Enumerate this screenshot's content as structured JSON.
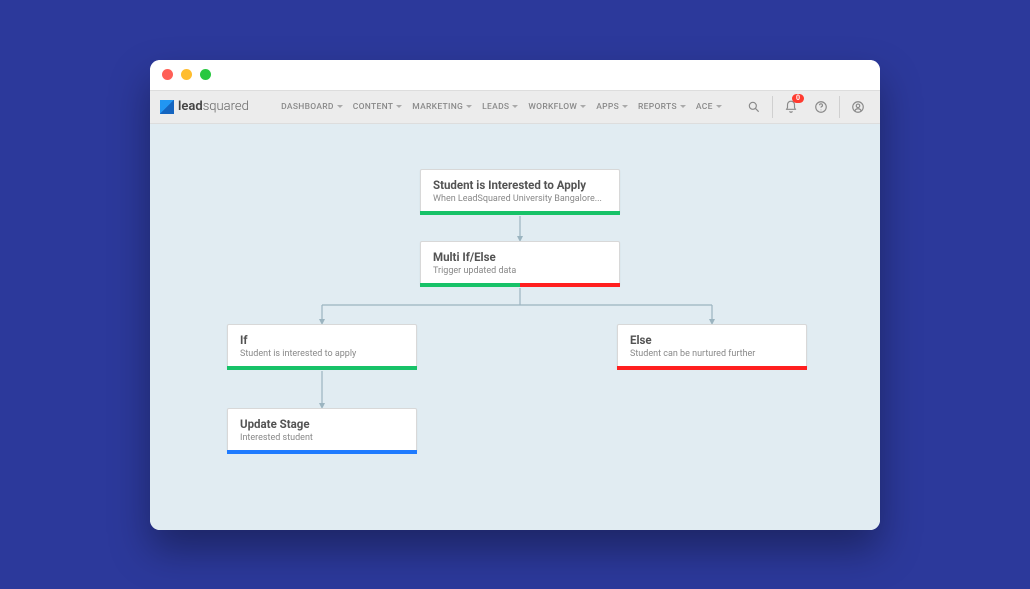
{
  "logo": {
    "brand_a": "lead",
    "brand_b": "squared"
  },
  "nav": {
    "items": [
      {
        "label": "DASHBOARD"
      },
      {
        "label": "CONTENT"
      },
      {
        "label": "MARKETING"
      },
      {
        "label": "LEADS"
      },
      {
        "label": "WORKFLOW"
      },
      {
        "label": "APPS"
      },
      {
        "label": "REPORTS"
      },
      {
        "label": "ACE"
      }
    ]
  },
  "notifications": {
    "count": "0"
  },
  "workflow": {
    "nodes": {
      "start": {
        "title": "Student is Interested to Apply",
        "sub": "When LeadSquared University Bangalore..."
      },
      "branch": {
        "title": "Multi If/Else",
        "sub": "Trigger updated data"
      },
      "if": {
        "title": "If",
        "sub": "Student is interested to apply"
      },
      "else": {
        "title": "Else",
        "sub": "Student can be nurtured further"
      },
      "update": {
        "title": "Update Stage",
        "sub": "Interested student"
      }
    }
  },
  "colors": {
    "green": "#17c268",
    "red": "#ff1f1f",
    "blue": "#1f7bff"
  }
}
